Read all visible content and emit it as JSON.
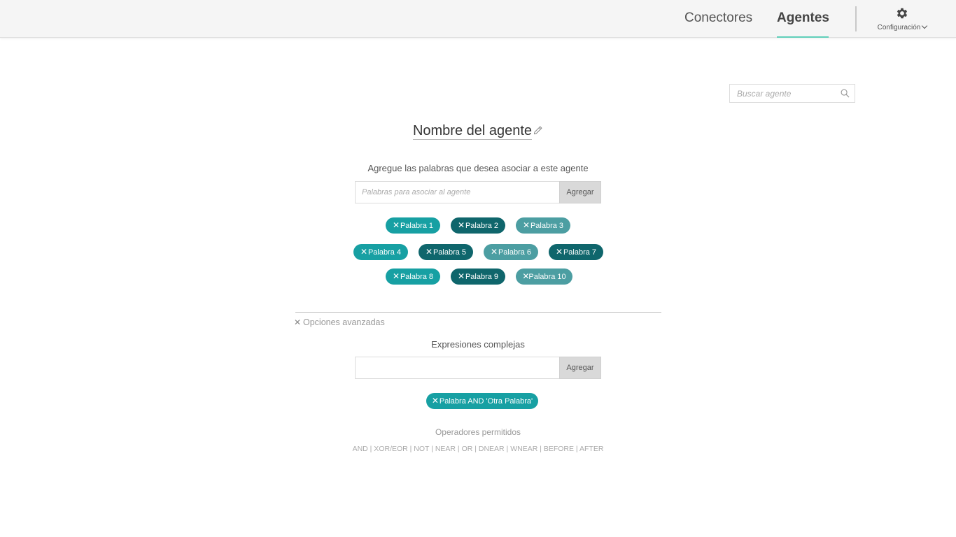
{
  "nav": {
    "conectores": "Conectores",
    "agentes": "Agentes",
    "config_label": "Configuración"
  },
  "search": {
    "placeholder": "Buscar agente"
  },
  "agent": {
    "name": "Nombre del agente"
  },
  "words": {
    "instruction": "Agregue las palabras que desea asociar a este agente",
    "input_placeholder": "Palabras para asociar al agente",
    "add_label": "Agregar",
    "chips": [
      "Palabra 1",
      "Palabra 2",
      "Palabra 3",
      "Palabra 4",
      "Palabra 5",
      "Palabra 6",
      "Palabra 7",
      "Palabra 8",
      "Palabra 9",
      "Palabra 10"
    ]
  },
  "advanced": {
    "label": "Opciones avanzadas"
  },
  "expressions": {
    "title": "Expresiones complejas",
    "input_value": "",
    "add_label": "Agregar",
    "chips": [
      "Palabra AND 'Otra Palabra'"
    ]
  },
  "operators": {
    "title": "Operadores permitidos",
    "list": "AND | XOR/EOR  |  NOT  |  NEAR  |  OR  |  DNEAR  |  WNEAR  |  BEFORE  |  AFTER"
  },
  "colors": {
    "chip_teal": "#17a0a3",
    "chip_dark": "#0f666c",
    "chip_muted": "#4c9ea2",
    "accent_underline": "#5fcfb9"
  }
}
